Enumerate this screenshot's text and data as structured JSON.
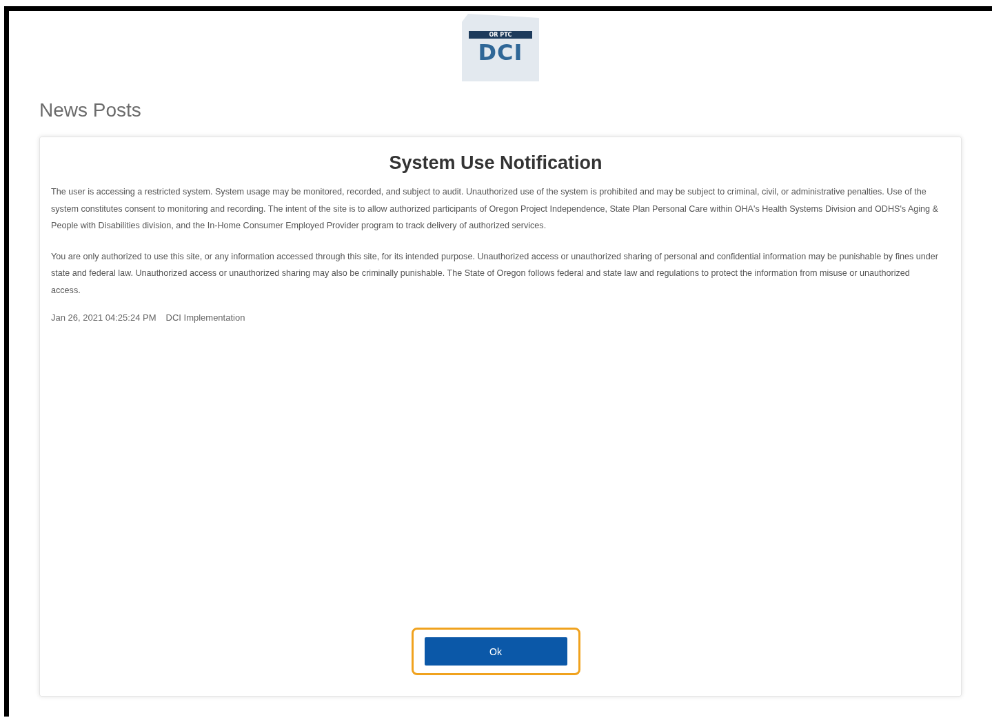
{
  "logo": {
    "band": "OR PTC",
    "letters": "DCI"
  },
  "page_title": "News Posts",
  "notice": {
    "title": "System Use Notification",
    "paragraphs": [
      "The user is accessing a restricted system.  System usage may be monitored, recorded, and subject to audit. Unauthorized use of the system is prohibited and may be subject to criminal, civil, or administrative penalties. Use of the system constitutes consent to monitoring and recording. The intent of the site is to allow authorized participants of Oregon Project Independence, State Plan Personal Care within OHA's Health Systems Division and ODHS's Aging & People with Disabilities division, and the In-Home Consumer Employed Provider program to track delivery of authorized services.",
      "You are only authorized to use this site, or any information accessed through this site, for its intended purpose. Unauthorized access or unauthorized sharing of personal and confidential information may be punishable by fines under state and federal law. Unauthorized access or unauthorized sharing may also be criminally punishable. The State of Oregon follows federal and state law and regulations to protect the information from misuse or unauthorized access."
    ],
    "date": "Jan 26, 2021 04:25:24 PM",
    "author": "DCI Implementation",
    "button": "Ok"
  }
}
